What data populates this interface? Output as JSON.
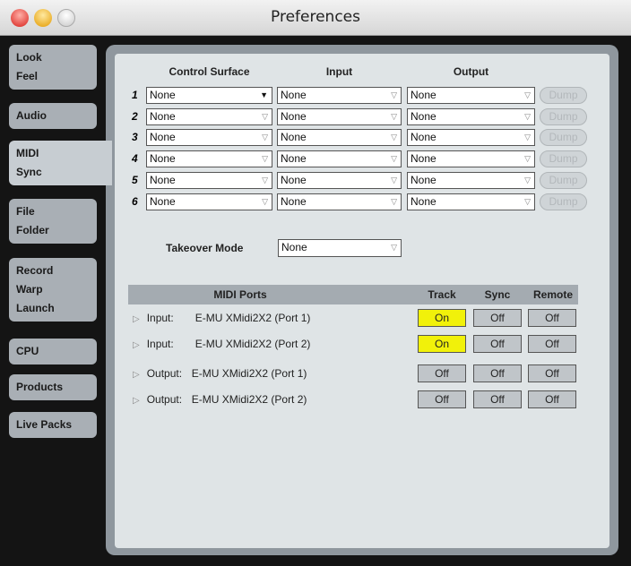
{
  "window": {
    "title": "Preferences"
  },
  "sidebar": {
    "tabs": [
      {
        "lines": [
          "Look",
          "Feel"
        ]
      },
      {
        "lines": [
          "Audio"
        ]
      },
      {
        "lines": [
          "MIDI",
          "Sync"
        ],
        "selected": true
      },
      {
        "lines": [
          "File",
          "Folder"
        ]
      },
      {
        "lines": [
          "Record",
          "Warp",
          "Launch"
        ]
      },
      {
        "lines": [
          "CPU"
        ]
      },
      {
        "lines": [
          "Products"
        ]
      },
      {
        "lines": [
          "Live Packs"
        ]
      }
    ]
  },
  "surfaces": {
    "headers": {
      "control_surface": "Control Surface",
      "input": "Input",
      "output": "Output"
    },
    "rows": [
      {
        "num": "1",
        "cs": "None",
        "input": "None",
        "output": "None",
        "dump": "Dump"
      },
      {
        "num": "2",
        "cs": "None",
        "input": "None",
        "output": "None",
        "dump": "Dump"
      },
      {
        "num": "3",
        "cs": "None",
        "input": "None",
        "output": "None",
        "dump": "Dump"
      },
      {
        "num": "4",
        "cs": "None",
        "input": "None",
        "output": "None",
        "dump": "Dump"
      },
      {
        "num": "5",
        "cs": "None",
        "input": "None",
        "output": "None",
        "dump": "Dump"
      },
      {
        "num": "6",
        "cs": "None",
        "input": "None",
        "output": "None",
        "dump": "Dump"
      }
    ]
  },
  "takeover": {
    "label": "Takeover Mode",
    "value": "None"
  },
  "ports": {
    "headers": {
      "name": "MIDI Ports",
      "track": "Track",
      "sync": "Sync",
      "remote": "Remote"
    },
    "rows": [
      {
        "type": "Input:",
        "device": "E-MU XMidi2X2 (Port 1)",
        "track": "On",
        "sync": "Off",
        "remote": "Off"
      },
      {
        "type": "Input:",
        "device": "E-MU XMidi2X2 (Port 2)",
        "track": "On",
        "sync": "Off",
        "remote": "Off"
      },
      {
        "type": "Output:",
        "device": "E-MU XMidi2X2 (Port 1)",
        "track": "Off",
        "sync": "Off",
        "remote": "Off"
      },
      {
        "type": "Output:",
        "device": "E-MU XMidi2X2 (Port 2)",
        "track": "Off",
        "sync": "Off",
        "remote": "Off"
      }
    ]
  },
  "colors": {
    "on": "#f1f10a",
    "off": "#c0c5c9"
  }
}
